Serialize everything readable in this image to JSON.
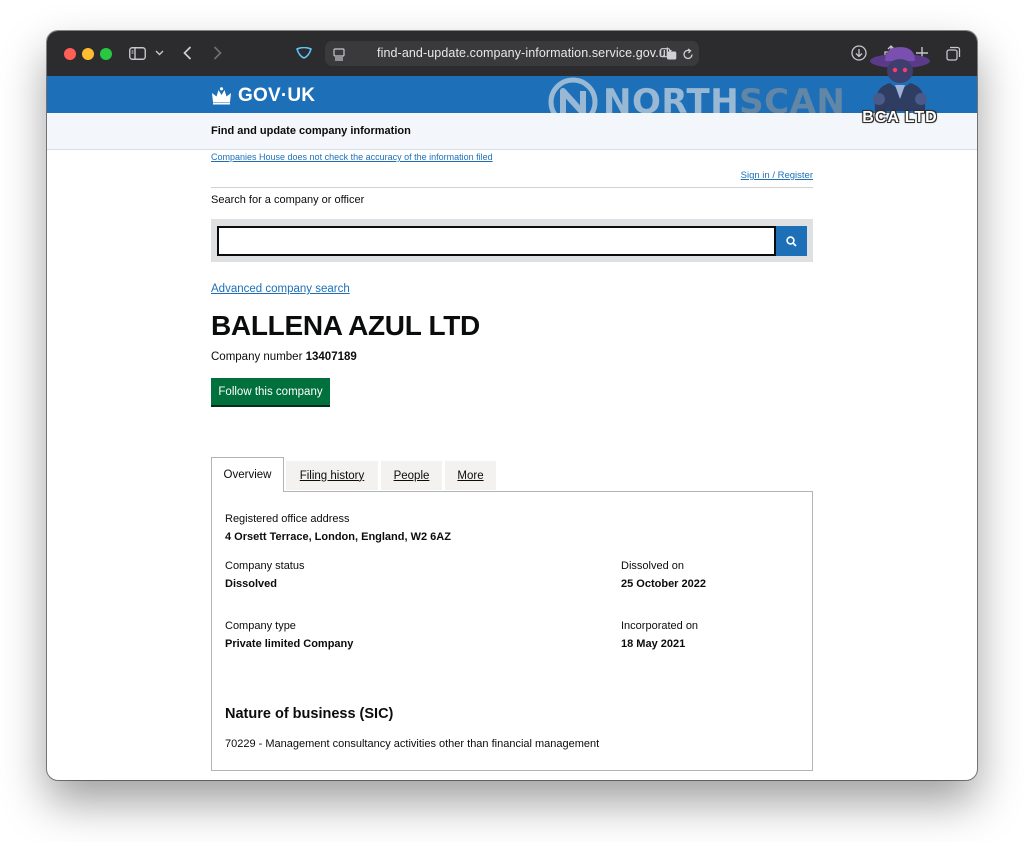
{
  "browser": {
    "url": "find-and-update.company-information.service.gov.uk"
  },
  "header": {
    "logo_text": "GOV·UK",
    "service_name": "Find and update company information"
  },
  "watermarks": {
    "northscan_bold": "NORTH",
    "northscan_light": "SCAN",
    "bca": "BCA LTD"
  },
  "notices": {
    "disclaimer": "Companies House does not check the accuracy of the information filed",
    "sign_in": "Sign in / Register"
  },
  "search": {
    "label": "Search for a company or officer",
    "value": "",
    "placeholder": ""
  },
  "advanced_search": "Advanced company search",
  "company": {
    "name": "BALLENA AZUL LTD",
    "number_label": "Company number",
    "number": "13407189",
    "follow_label": "Follow this company"
  },
  "tabs": [
    {
      "label": "Overview",
      "active": true
    },
    {
      "label": "Filing history",
      "active": false
    },
    {
      "label": "People",
      "active": false
    },
    {
      "label": "More",
      "active": false
    }
  ],
  "overview": {
    "office_label": "Registered office address",
    "office_value": "4 Orsett Terrace, London, England, W2 6AZ",
    "status_label": "Company status",
    "status_value": "Dissolved",
    "dissolved_label": "Dissolved on",
    "dissolved_value": "25 October 2022",
    "type_label": "Company type",
    "type_value": "Private limited Company",
    "incorporated_label": "Incorporated on",
    "incorporated_value": "18 May 2021",
    "sic_heading": "Nature of business (SIC)",
    "sic_value": "70229 - Management consultancy activities other than financial management"
  },
  "colors": {
    "gov_blue": "#1d70b8",
    "button_green": "#00703c",
    "toolbar": "#2c2c2e"
  },
  "icons": [
    "sidebar-icon",
    "chevron-down-icon",
    "back-icon",
    "forward-icon",
    "shield-icon",
    "page-menu-icon",
    "translate-icon",
    "reload-icon",
    "download-icon",
    "share-icon",
    "new-tab-icon",
    "tabs-overview-icon",
    "crown-icon",
    "search-icon"
  ]
}
